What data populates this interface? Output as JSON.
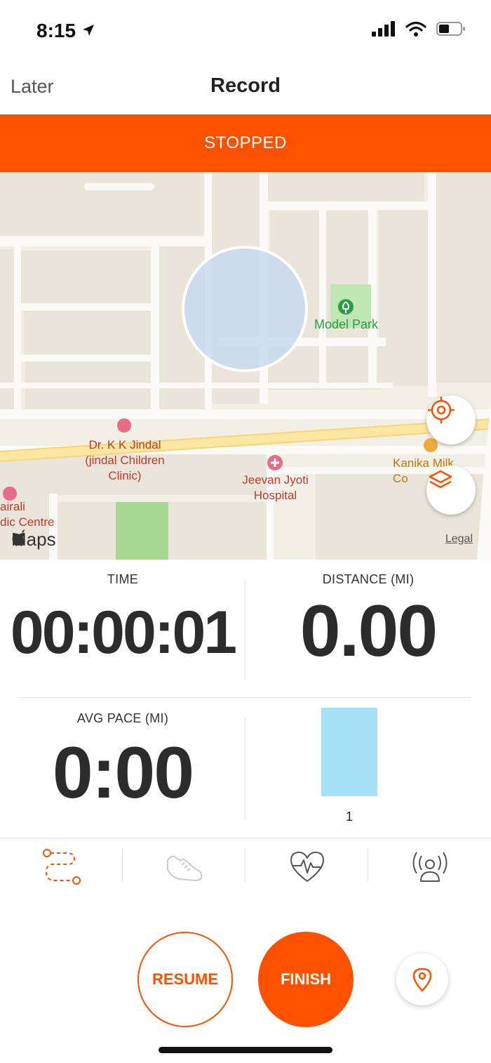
{
  "status_bar": {
    "time": "8:15"
  },
  "nav": {
    "left_label": "Later",
    "title": "Record"
  },
  "banner": {
    "text": "STOPPED",
    "color": "#fc5200"
  },
  "map": {
    "labels": {
      "model_park": "Model Park",
      "kk_jindal": "Dr. K K Jindal\n(jindal Children\nClinic)",
      "jeevan_jyoti": "Jeevan Jyoti\nHospital",
      "kanika": "Kanika Milk\nCo",
      "airali": "airali\ndic Centre"
    },
    "logo": "Maps",
    "legal": "Legal"
  },
  "stats": {
    "time": {
      "label": "TIME",
      "value": "00:00:01"
    },
    "distance": {
      "label": "DISTANCE (MI)",
      "value": "0.00"
    },
    "avg_pace": {
      "label": "AVG PACE (MI)",
      "value": "0:00"
    },
    "split_chart": {
      "label": "1",
      "bar_color": "#a6e1f7"
    }
  },
  "tabs": [
    {
      "icon": "route-icon",
      "active": true
    },
    {
      "icon": "shoe-icon",
      "active": false
    },
    {
      "icon": "heart-rate-icon",
      "active": false
    },
    {
      "icon": "beacon-icon",
      "active": false
    }
  ],
  "buttons": {
    "resume": "RESUME",
    "finish": "FINISH"
  },
  "colors": {
    "accent": "#fc5200",
    "text_dark": "#2c2c2c"
  }
}
